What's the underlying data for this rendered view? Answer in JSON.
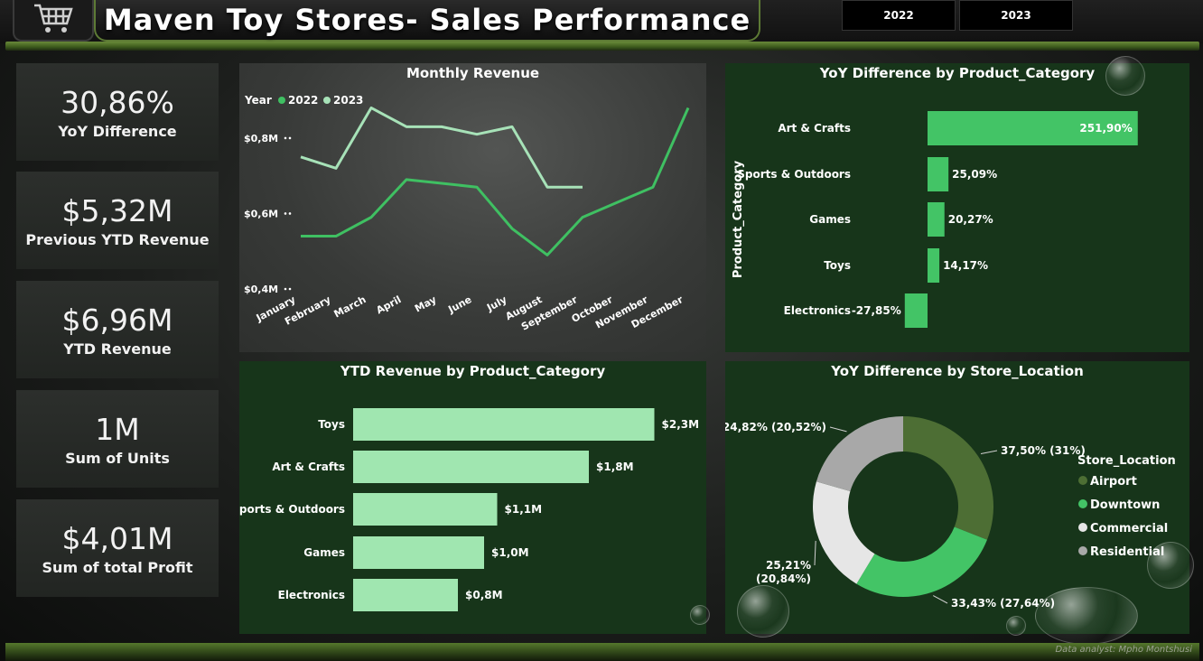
{
  "header": {
    "title": "Maven Toy Stores- Sales Performance",
    "year_buttons": [
      "2022",
      "2023"
    ]
  },
  "kpis": [
    {
      "value": "30,86%",
      "label": "YoY Difference"
    },
    {
      "value": "$5,32M",
      "label": "Previous YTD Revenue"
    },
    {
      "value": "$6,96M",
      "label": "YTD Revenue"
    },
    {
      "value": "1M",
      "label": "Sum of Units"
    },
    {
      "value": "$4,01M",
      "label": "Sum of total Profit"
    }
  ],
  "footer": {
    "credit": "Data analyst: Mpho Montshusi"
  },
  "colors": {
    "series_2022": "#3fc062",
    "series_2023": "#a7e2b8",
    "bar_light": "#a0e6b0",
    "bar_green": "#43c466"
  },
  "chart_data": [
    {
      "id": "monthly",
      "type": "line",
      "title": "Monthly Revenue",
      "legend_title": "Year",
      "x": [
        "January",
        "February",
        "March",
        "April",
        "May",
        "June",
        "July",
        "August",
        "September",
        "October",
        "November",
        "December"
      ],
      "y_ticks": [
        0.4,
        0.6,
        0.8
      ],
      "y_tick_labels": [
        "$0,4M",
        "$0,6M",
        "$0,8M"
      ],
      "ylim": [
        0.4,
        0.85
      ],
      "series": [
        {
          "name": "2022",
          "color": "#3fc062",
          "values": [
            0.54,
            0.54,
            0.59,
            0.69,
            0.68,
            0.67,
            0.56,
            0.49,
            0.59,
            0.63,
            0.67,
            0.88
          ]
        },
        {
          "name": "2023",
          "color": "#a7e2b8",
          "values": [
            0.75,
            0.72,
            0.88,
            0.83,
            0.83,
            0.81,
            0.83,
            0.67,
            0.67,
            null,
            null,
            null
          ]
        }
      ],
      "legend": "top-left"
    },
    {
      "id": "yoy_product",
      "type": "bar",
      "title": "YoY Difference by Product_Category",
      "ylabel": "Product_Category",
      "categories": [
        "Art & Crafts",
        "Sports & Outdoors",
        "Games",
        "Toys",
        "Electronics"
      ],
      "values": [
        251.9,
        25.09,
        20.27,
        14.17,
        -27.85
      ],
      "value_labels": [
        "251,90%",
        "25,09%",
        "20,27%",
        "14,17%",
        "-27,85%"
      ],
      "color": "#43c466"
    },
    {
      "id": "ytd_product",
      "type": "bar",
      "title": "YTD Revenue by Product_Category",
      "categories": [
        "Toys",
        "Art & Crafts",
        "Sports & Outdoors",
        "Games",
        "Electronics"
      ],
      "values": [
        2.3,
        1.8,
        1.1,
        1.0,
        0.8
      ],
      "value_labels": [
        "$2,3M",
        "$1,8M",
        "$1,1M",
        "$1,0M",
        "$0,8M"
      ],
      "color": "#a0e6b0"
    },
    {
      "id": "yoy_location",
      "type": "pie",
      "title": "YoY Difference by Store_Location",
      "legend_title": "Store_Location",
      "slices": [
        {
          "name": "Airport",
          "value": 31.0,
          "label": "37,50% (31%)",
          "color": "#4d6e34"
        },
        {
          "name": "Downtown",
          "value": 27.64,
          "label": "33,43% (27,64%)",
          "color": "#43c466"
        },
        {
          "name": "Commercial",
          "value": 20.84,
          "label_lines": [
            "25,21%",
            "(20,84%)"
          ],
          "color": "#e6e6e6"
        },
        {
          "name": "Residential",
          "value": 20.52,
          "label": "24,82% (20,52%)",
          "color": "#a8a8a8"
        }
      ],
      "legend": "right"
    }
  ]
}
